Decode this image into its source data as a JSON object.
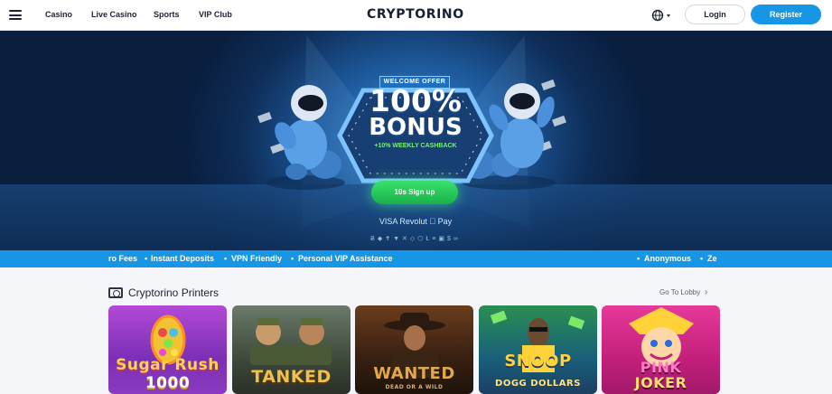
{
  "header": {
    "nav": [
      "Casino",
      "Live Casino",
      "Sports",
      "VIP Club"
    ],
    "logo": "CRYPTORINO",
    "login_label": "Login",
    "register_label": "Register",
    "icons": [
      "menu-icon",
      "globe-icon",
      "caret-down-icon"
    ]
  },
  "hero": {
    "tag": "WELCOME OFFER",
    "headline_1": "100%",
    "headline_2": "BONUS",
    "subline": "+10% WEEKLY CASHBACK",
    "cta_label": "10s Sign up",
    "payments": "VISA  Revolut   Pay",
    "crypto_icons": "Ƀ◆✝▼✕◇⬡Ł≡▣$∞"
  },
  "ticker": {
    "items": [
      "ro Fees",
      "Instant Deposits",
      "VPN Friendly",
      "Personal VIP Assistance",
      "Anonymous",
      "Ze"
    ]
  },
  "section": {
    "title": "Cryptorino Printers",
    "link": "Go To Lobby",
    "games": [
      {
        "name": "Sugar Rush",
        "sub": "1000",
        "color": "#ffd54a"
      },
      {
        "name": "TANKED",
        "sub": "",
        "color": "#f0c04a"
      },
      {
        "name": "WANTED",
        "sub": "DEAD OR A WILD",
        "color": "#e0a84a"
      },
      {
        "name": "SNOOP",
        "sub": "DOGG DOLLARS",
        "color": "#ffd23a"
      },
      {
        "name": "PINK",
        "sub": "JOKER",
        "color": "#ffe06a"
      }
    ]
  },
  "colors": {
    "accent": "#1796e6",
    "cta": "#22c25a",
    "dark": "#1d2333"
  }
}
